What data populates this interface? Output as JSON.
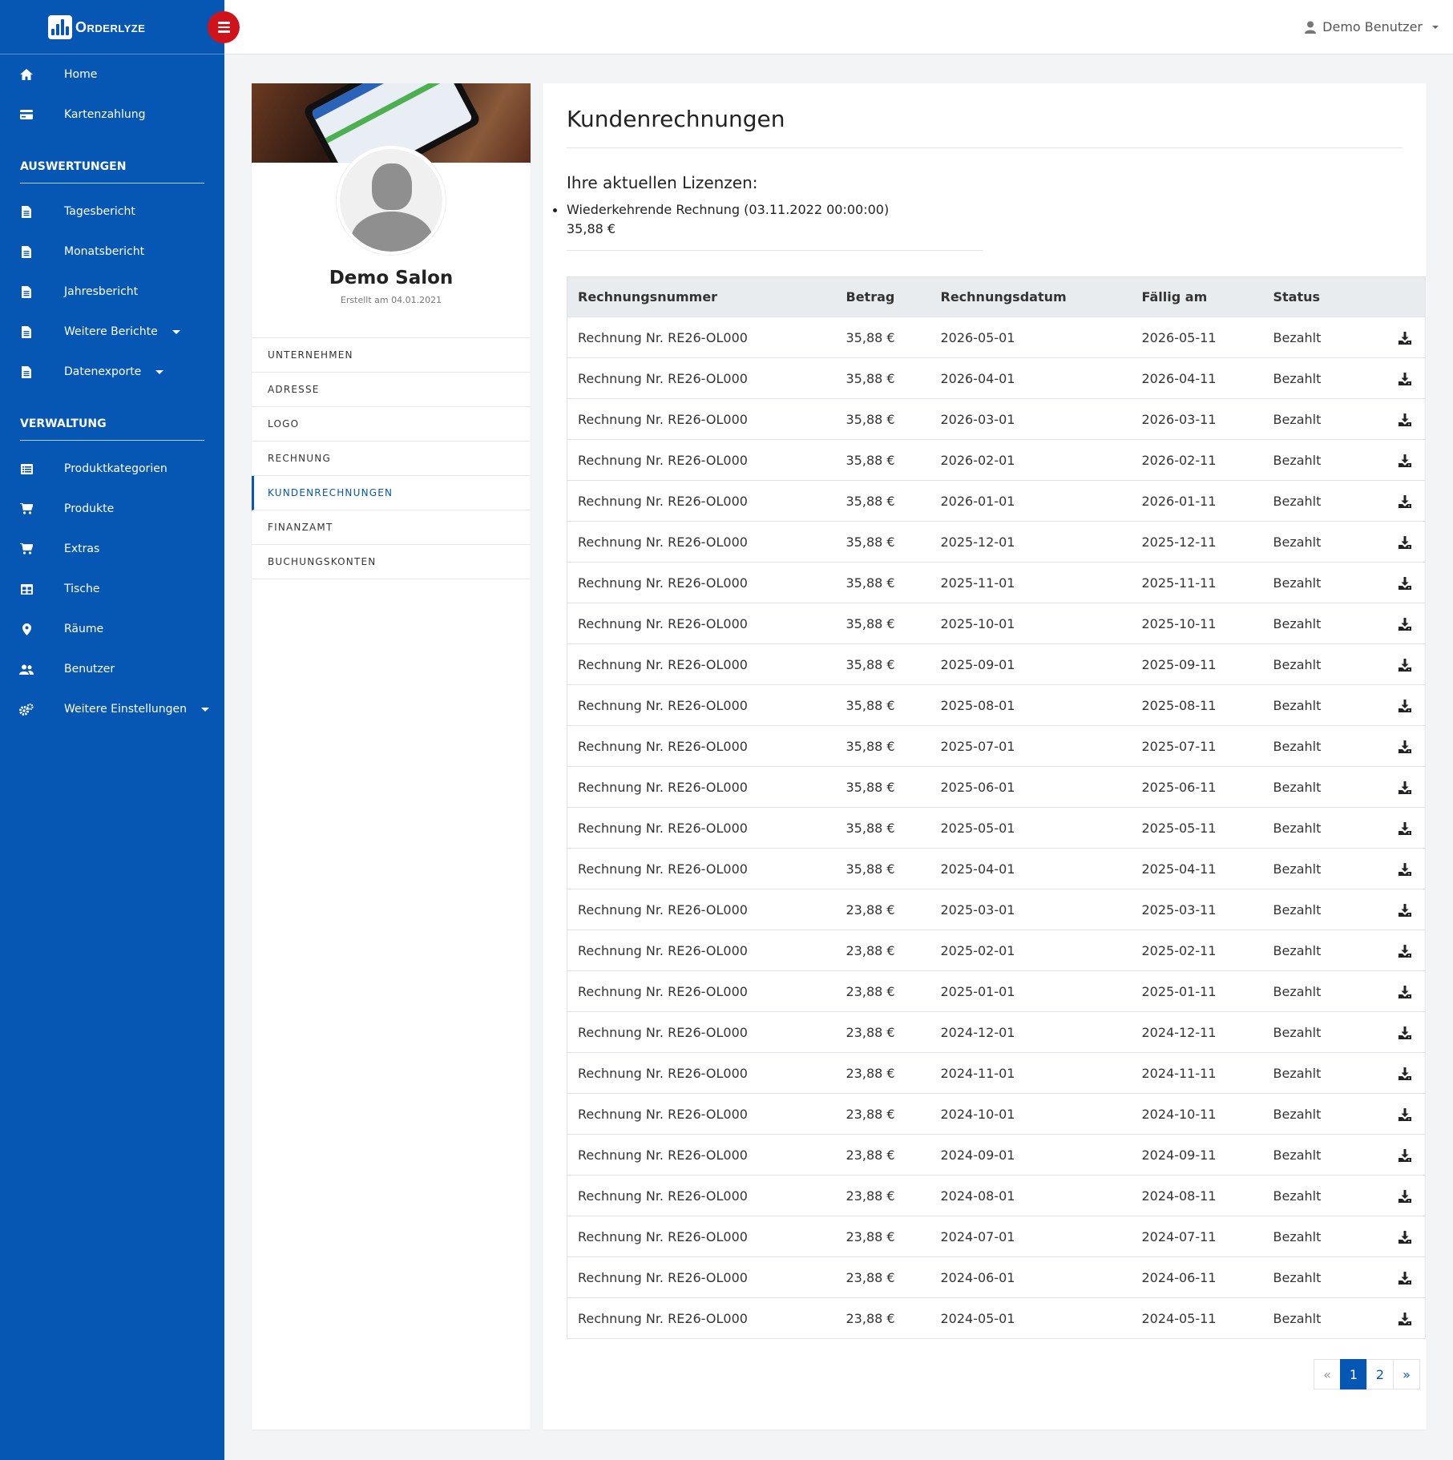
{
  "app": {
    "brand": "Orderlyze"
  },
  "sidebar": {
    "top_items": [
      {
        "label": "Home",
        "icon": "home-icon"
      },
      {
        "label": "Kartenzahlung",
        "icon": "credit-card-icon"
      }
    ],
    "section1_title": "AUSWERTUNGEN",
    "section1_items": [
      {
        "label": "Tagesbericht",
        "icon": "file-icon"
      },
      {
        "label": "Monatsbericht",
        "icon": "file-icon"
      },
      {
        "label": "Jahresbericht",
        "icon": "file-icon"
      },
      {
        "label": "Weitere Berichte",
        "icon": "file-icon",
        "dropdown": true
      },
      {
        "label": "Datenexporte",
        "icon": "file-icon",
        "dropdown": true
      }
    ],
    "section2_title": "VERWALTUNG",
    "section2_items": [
      {
        "label": "Produktkategorien",
        "icon": "list-icon"
      },
      {
        "label": "Produkte",
        "icon": "cart-icon"
      },
      {
        "label": "Extras",
        "icon": "cart-icon"
      },
      {
        "label": "Tische",
        "icon": "table-icon"
      },
      {
        "label": "Räume",
        "icon": "map-pin-icon"
      },
      {
        "label": "Benutzer",
        "icon": "users-icon"
      },
      {
        "label": "Weitere Einstellungen",
        "icon": "gears-icon",
        "dropdown": true
      }
    ]
  },
  "topbar": {
    "user_name": "Demo Benutzer"
  },
  "profile": {
    "name": "Demo Salon",
    "created": "Erstellt am 04.01.2021",
    "menu": [
      "UNTERNEHMEN",
      "ADRESSE",
      "LOGO",
      "RECHNUNG",
      "KUNDENRECHNUNGEN",
      "FINANZAMT",
      "BUCHUNGSKONTEN"
    ],
    "active_menu": "KUNDENRECHNUNGEN"
  },
  "content": {
    "title": "Kundenrechnungen",
    "licenses_heading": "Ihre aktuellen Lizenzen:",
    "license_item": "Wiederkehrende Rechnung (03.11.2022 00:00:00)",
    "license_price": "35,88 €",
    "table": {
      "headers": [
        "Rechnungsnummer",
        "Betrag",
        "Rechnungsdatum",
        "Fällig am",
        "Status"
      ],
      "rows": [
        [
          "Rechnung Nr. RE26-OL000",
          "35,88 €",
          "2026-05-01",
          "2026-05-11",
          "Bezahlt"
        ],
        [
          "Rechnung Nr. RE26-OL000",
          "35,88 €",
          "2026-04-01",
          "2026-04-11",
          "Bezahlt"
        ],
        [
          "Rechnung Nr. RE26-OL000",
          "35,88 €",
          "2026-03-01",
          "2026-03-11",
          "Bezahlt"
        ],
        [
          "Rechnung Nr. RE26-OL000",
          "35,88 €",
          "2026-02-01",
          "2026-02-11",
          "Bezahlt"
        ],
        [
          "Rechnung Nr. RE26-OL000",
          "35,88 €",
          "2026-01-01",
          "2026-01-11",
          "Bezahlt"
        ],
        [
          "Rechnung Nr. RE26-OL000",
          "35,88 €",
          "2025-12-01",
          "2025-12-11",
          "Bezahlt"
        ],
        [
          "Rechnung Nr. RE26-OL000",
          "35,88 €",
          "2025-11-01",
          "2025-11-11",
          "Bezahlt"
        ],
        [
          "Rechnung Nr. RE26-OL000",
          "35,88 €",
          "2025-10-01",
          "2025-10-11",
          "Bezahlt"
        ],
        [
          "Rechnung Nr. RE26-OL000",
          "35,88 €",
          "2025-09-01",
          "2025-09-11",
          "Bezahlt"
        ],
        [
          "Rechnung Nr. RE26-OL000",
          "35,88 €",
          "2025-08-01",
          "2025-08-11",
          "Bezahlt"
        ],
        [
          "Rechnung Nr. RE26-OL000",
          "35,88 €",
          "2025-07-01",
          "2025-07-11",
          "Bezahlt"
        ],
        [
          "Rechnung Nr. RE26-OL000",
          "35,88 €",
          "2025-06-01",
          "2025-06-11",
          "Bezahlt"
        ],
        [
          "Rechnung Nr. RE26-OL000",
          "35,88 €",
          "2025-05-01",
          "2025-05-11",
          "Bezahlt"
        ],
        [
          "Rechnung Nr. RE26-OL000",
          "35,88 €",
          "2025-04-01",
          "2025-04-11",
          "Bezahlt"
        ],
        [
          "Rechnung Nr. RE26-OL000",
          "23,88 €",
          "2025-03-01",
          "2025-03-11",
          "Bezahlt"
        ],
        [
          "Rechnung Nr. RE26-OL000",
          "23,88 €",
          "2025-02-01",
          "2025-02-11",
          "Bezahlt"
        ],
        [
          "Rechnung Nr. RE26-OL000",
          "23,88 €",
          "2025-01-01",
          "2025-01-11",
          "Bezahlt"
        ],
        [
          "Rechnung Nr. RE26-OL000",
          "23,88 €",
          "2024-12-01",
          "2024-12-11",
          "Bezahlt"
        ],
        [
          "Rechnung Nr. RE26-OL000",
          "23,88 €",
          "2024-11-01",
          "2024-11-11",
          "Bezahlt"
        ],
        [
          "Rechnung Nr. RE26-OL000",
          "23,88 €",
          "2024-10-01",
          "2024-10-11",
          "Bezahlt"
        ],
        [
          "Rechnung Nr. RE26-OL000",
          "23,88 €",
          "2024-09-01",
          "2024-09-11",
          "Bezahlt"
        ],
        [
          "Rechnung Nr. RE26-OL000",
          "23,88 €",
          "2024-08-01",
          "2024-08-11",
          "Bezahlt"
        ],
        [
          "Rechnung Nr. RE26-OL000",
          "23,88 €",
          "2024-07-01",
          "2024-07-11",
          "Bezahlt"
        ],
        [
          "Rechnung Nr. RE26-OL000",
          "23,88 €",
          "2024-06-01",
          "2024-06-11",
          "Bezahlt"
        ],
        [
          "Rechnung Nr. RE26-OL000",
          "23,88 €",
          "2024-05-01",
          "2024-05-11",
          "Bezahlt"
        ]
      ]
    },
    "pagination": {
      "prev": "«",
      "pages": [
        "1",
        "2"
      ],
      "active": "1",
      "next": "»"
    }
  },
  "colors": {
    "primary": "#0656b3",
    "toggle": "#d0131b",
    "header_bg": "#e9ecef"
  }
}
